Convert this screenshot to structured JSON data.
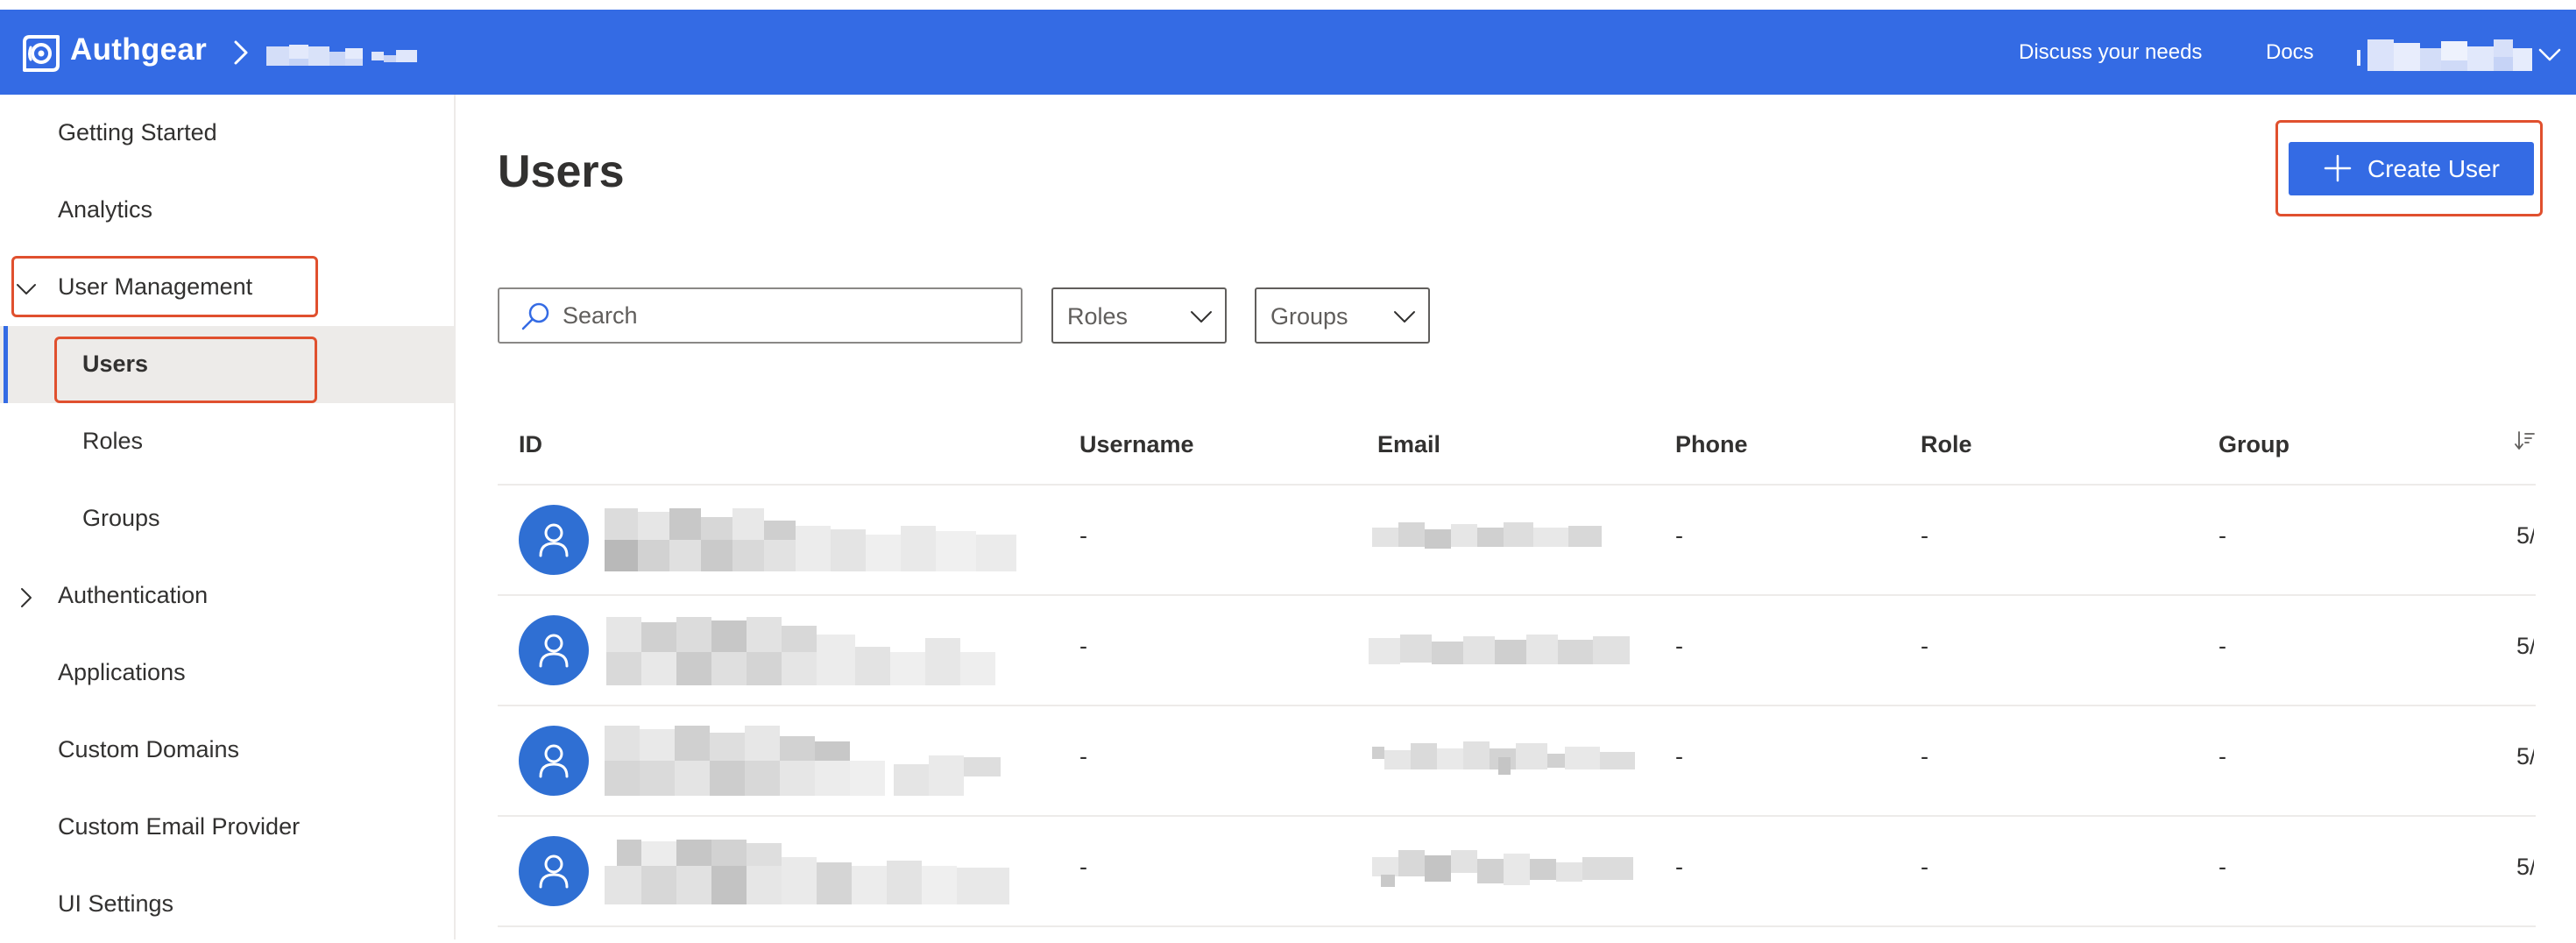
{
  "header": {
    "brand": "Authgear",
    "links": {
      "discuss": "Discuss your needs",
      "docs": "Docs"
    },
    "brand_color": "#346be4"
  },
  "sidebar": {
    "items": [
      {
        "label": "Getting Started"
      },
      {
        "label": "Analytics"
      },
      {
        "label": "User Management",
        "expanded": true
      },
      {
        "label": "Users",
        "selected": true
      },
      {
        "label": "Roles"
      },
      {
        "label": "Groups"
      },
      {
        "label": "Authentication",
        "expanded": false
      },
      {
        "label": "Applications"
      },
      {
        "label": "Custom Domains"
      },
      {
        "label": "Custom Email Provider"
      },
      {
        "label": "UI Settings"
      }
    ]
  },
  "main": {
    "title": "Users",
    "create_button": "Create User",
    "search": {
      "placeholder": "Search",
      "value": ""
    },
    "filters": {
      "roles": "Roles",
      "groups": "Groups"
    },
    "table": {
      "columns": [
        "ID",
        "Username",
        "Email",
        "Phone",
        "Role",
        "Group"
      ],
      "rows": [
        {
          "username": "-",
          "phone": "-",
          "role": "-",
          "group": "-",
          "last": "5/"
        },
        {
          "username": "-",
          "phone": "-",
          "role": "-",
          "group": "-",
          "last": "5/"
        },
        {
          "username": "-",
          "phone": "-",
          "role": "-",
          "group": "-",
          "last": "5/"
        },
        {
          "username": "-",
          "phone": "-",
          "role": "-",
          "group": "-",
          "last": "5/"
        }
      ]
    }
  },
  "highlight_color": "#e0502e"
}
